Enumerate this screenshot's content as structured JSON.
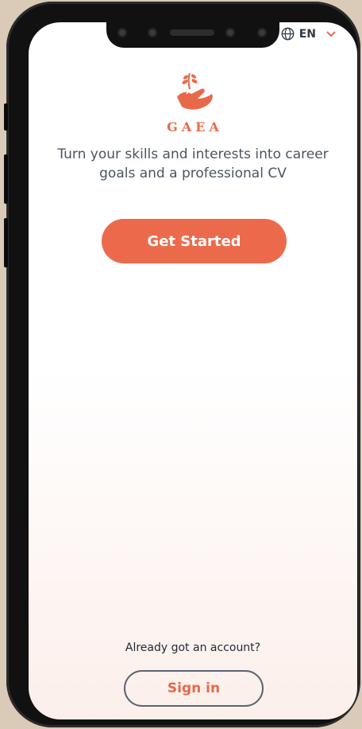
{
  "language": {
    "code": "EN",
    "icon": "globe-icon",
    "chevron": "chevron-down-icon"
  },
  "brand": {
    "name": "GAEA",
    "icon": "hand-with-sprout-logo"
  },
  "tagline": "Turn your skills and interests into career goals and a professional CV",
  "actions": {
    "get_started_label": "Get Started",
    "account_prompt": "Already got an account?",
    "sign_in_label": "Sign in"
  },
  "colors": {
    "accent": "#ec6a4c",
    "text": "#4a5563",
    "background_bottom": "#fcefea"
  }
}
